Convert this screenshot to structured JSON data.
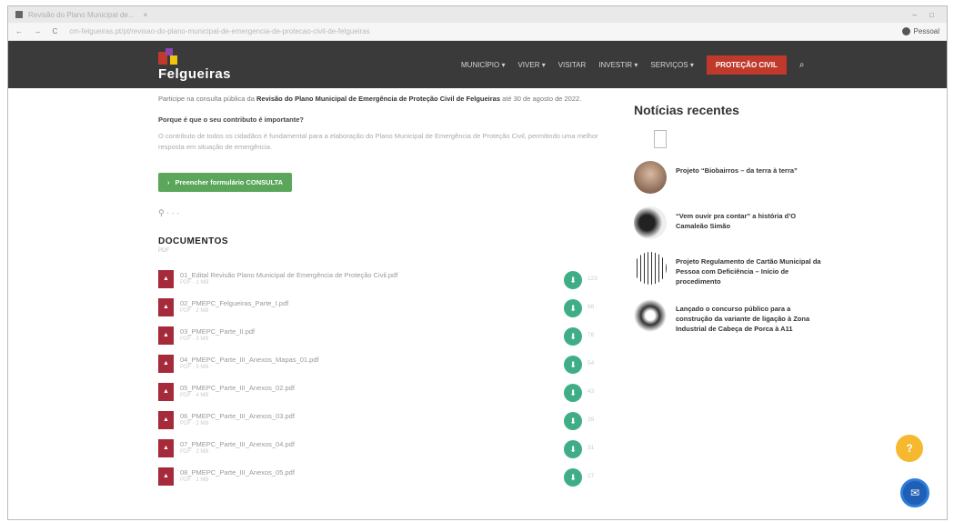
{
  "browser": {
    "tab_title": "Revisão do Plano Municipal de...",
    "tab_close": "×",
    "window_controls": "– □",
    "nav_icons": "← → C",
    "url": "cm-felgueiras.pt/pt/revisao-do-plano-municipal-de-emergencia-de-protecao-civil-de-felgueiras",
    "profile_label": "Pessoal"
  },
  "site": {
    "logo_text": "Felgueiras",
    "nav": [
      {
        "label": "MUNICÍPIO ▾"
      },
      {
        "label": "VIVER ▾"
      },
      {
        "label": "VISITAR"
      },
      {
        "label": "INVESTIR ▾"
      },
      {
        "label": "SERVIÇOS ▾"
      }
    ],
    "cta_label": "PROTEÇÃO CIVIL",
    "search_glyph": "⌕"
  },
  "main": {
    "intro_prefix": "Participe na consulta pública da",
    "intro_bold": "Revisão do Plano Municipal de Emergência de Proteção Civil de",
    "intro_bold2": "Felgueiras",
    "intro_suffix": "até 30 de agosto de 2022.",
    "question": "Porque é que o seu contributo é importante?",
    "paragraph": "O contributo de todos os cidadãos é fundamental para a elaboração do Plano Municipal de Emergência de Proteção Civil, permitindo uma melhor resposta em situação de emergência.",
    "form_button": "Preencher formulário CONSULTA",
    "share_glyph": "⚲ · · ·",
    "documents_title": "DOCUMENTOS",
    "documents_sub": "PDF",
    "documents": [
      {
        "name": "01_Edital Revisão Plano Municipal de Emergência de Proteção Civil.pdf",
        "meta": "PDF · 1 MB",
        "downloads": "123"
      },
      {
        "name": "02_PMEPC_Felgueiras_Parte_I.pdf",
        "meta": "PDF · 2 MB",
        "downloads": "98"
      },
      {
        "name": "03_PMEPC_Parte_II.pdf",
        "meta": "PDF · 3 MB",
        "downloads": "76"
      },
      {
        "name": "04_PMEPC_Parte_III_Anexos_Mapas_01.pdf",
        "meta": "PDF · 5 MB",
        "downloads": "54"
      },
      {
        "name": "05_PMEPC_Parte_III_Anexos_02.pdf",
        "meta": "PDF · 4 MB",
        "downloads": "43"
      },
      {
        "name": "06_PMEPC_Parte_III_Anexos_03.pdf",
        "meta": "PDF · 2 MB",
        "downloads": "39"
      },
      {
        "name": "07_PMEPC_Parte_III_Anexos_04.pdf",
        "meta": "PDF · 2 MB",
        "downloads": "31"
      },
      {
        "name": "08_PMEPC_Parte_III_Anexos_05.pdf",
        "meta": "PDF · 1 MB",
        "downloads": "27"
      }
    ],
    "download_glyph": "⬇",
    "pdf_glyph": "▲"
  },
  "sidebar": {
    "title": "Notícias recentes",
    "news": [
      {
        "title": "Projeto “Biobairros – da terra à terra”"
      },
      {
        "title": "“Vem ouvir pra contar” a história d’O Camaleão Simão"
      },
      {
        "title": "Projeto Regulamento de Cartão Municipal da Pessoa com Deficiência – Início de procedimento"
      },
      {
        "title": "Lançado o concurso público para a construção da variante de ligação à Zona Industrial de Cabeça de Porca à A11"
      }
    ]
  },
  "fabs": {
    "help_glyph": "?",
    "chat_glyph": "✉"
  }
}
